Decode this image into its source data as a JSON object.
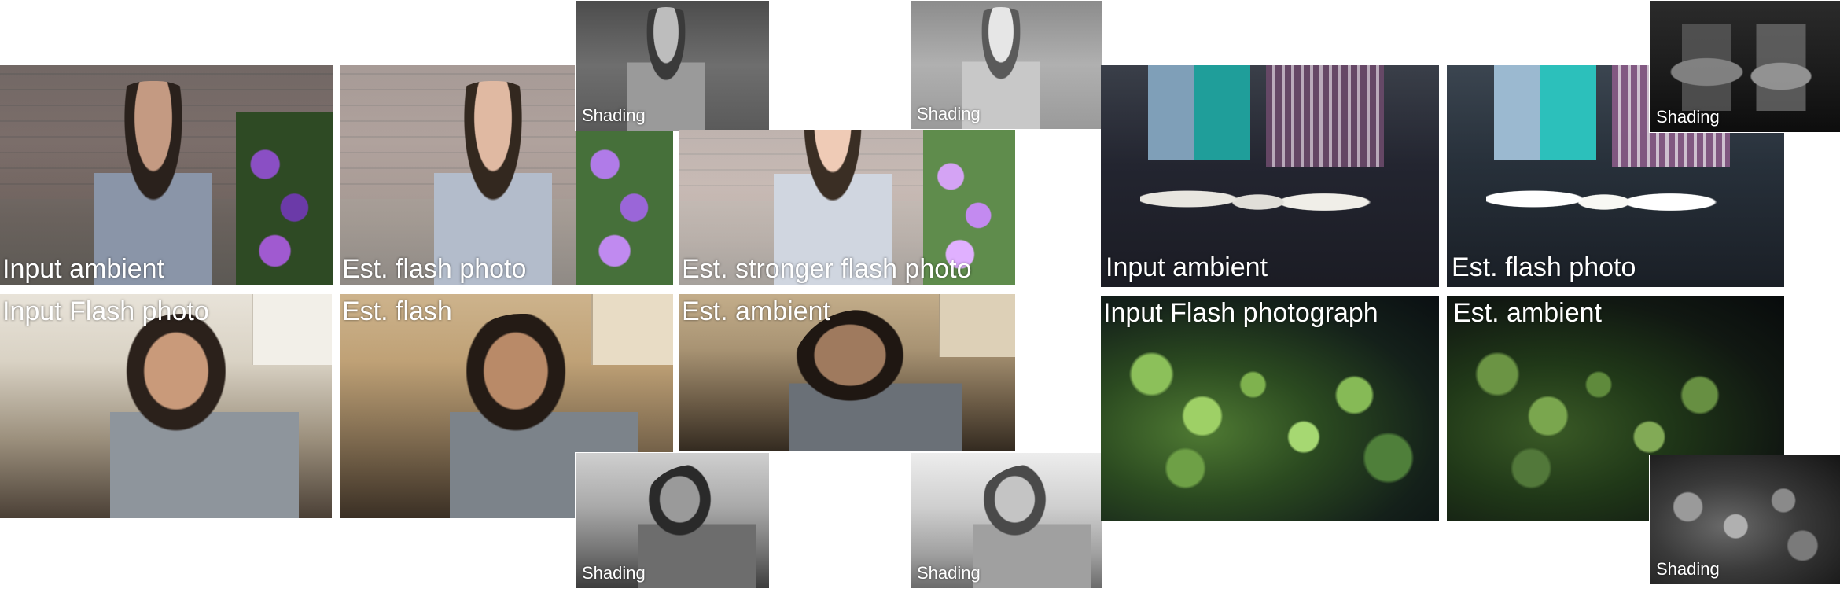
{
  "labels": {
    "input_ambient": "Input ambient",
    "est_flash_photo": "Est. flash photo",
    "est_stronger_flash_photo": "Est. stronger flash photo",
    "input_flash_photo": "Input Flash photo",
    "est_flash": "Est. flash",
    "est_ambient": "Est. ambient",
    "input_flash_photograph": "Input Flash photograph",
    "shading": "Shading"
  },
  "colors": {
    "background": "#ffffff",
    "label_text": "#ffffff"
  }
}
